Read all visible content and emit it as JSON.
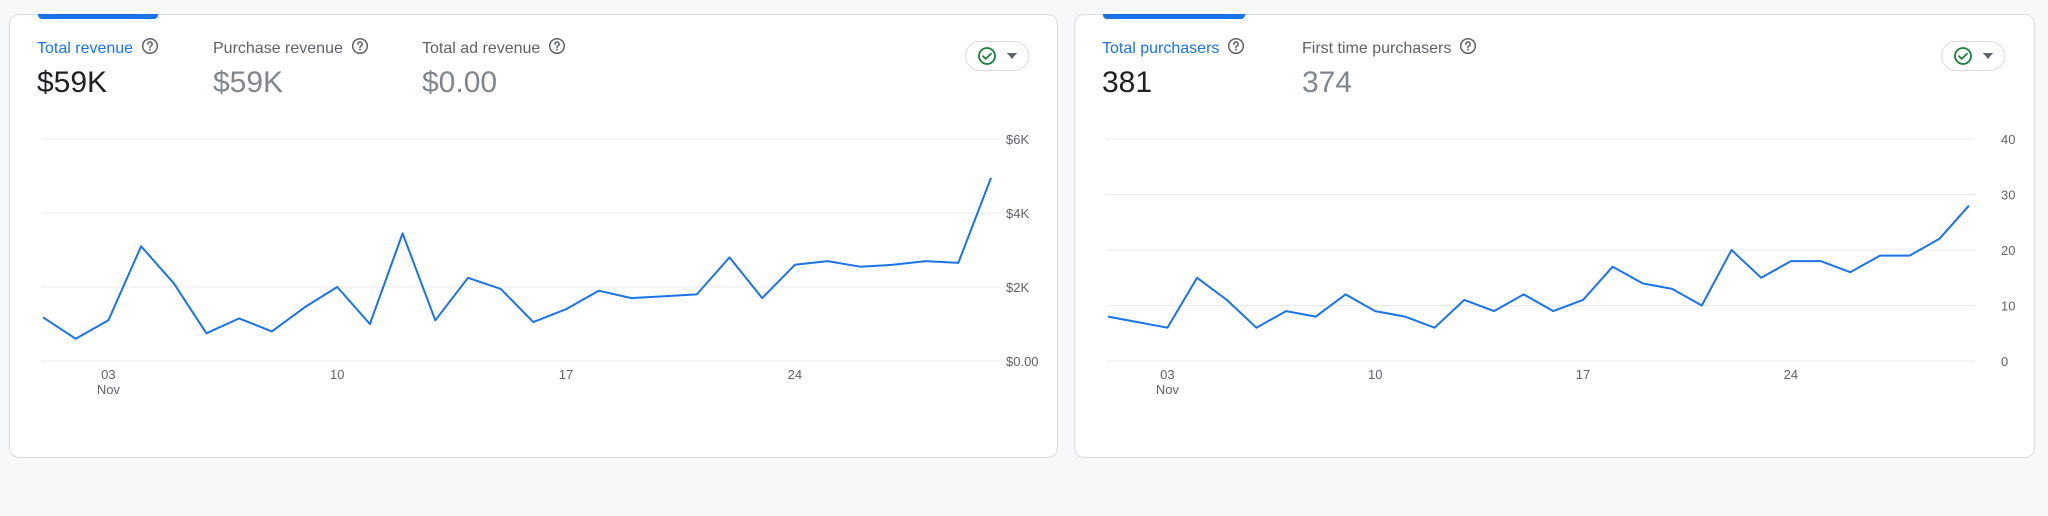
{
  "revenue_card": {
    "metrics": [
      {
        "label": "Total revenue",
        "value": "$59K",
        "active": true
      },
      {
        "label": "Purchase revenue",
        "value": "$59K",
        "active": false
      },
      {
        "label": "Total ad revenue",
        "value": "$0.00",
        "active": false
      }
    ]
  },
  "purchasers_card": {
    "metrics": [
      {
        "label": "Total purchasers",
        "value": "381",
        "active": true
      },
      {
        "label": "First time purchasers",
        "value": "374",
        "active": false
      }
    ]
  },
  "colors": {
    "accent": "#1a73e8",
    "check": "#188038",
    "grid": "#e8eaed"
  },
  "chart_data": [
    {
      "type": "line",
      "series": [
        {
          "values": [
            1180,
            600,
            1100,
            3100,
            2100,
            750,
            1150,
            800,
            1450,
            2000,
            1000,
            3450,
            1100,
            2250,
            1950,
            1050,
            1400,
            1900,
            1700,
            1750,
            1800,
            2800,
            1700,
            2600,
            2700,
            2550,
            2600,
            2700,
            2650,
            4950
          ]
        }
      ],
      "x": [
        1,
        2,
        3,
        4,
        5,
        6,
        7,
        8,
        9,
        10,
        11,
        12,
        13,
        14,
        15,
        16,
        17,
        18,
        19,
        20,
        21,
        22,
        23,
        24,
        25,
        26,
        27,
        28,
        29,
        30
      ],
      "x_tick_labels": [
        {
          "x": 3,
          "label": "03",
          "sub": "Nov"
        },
        {
          "x": 10,
          "label": "10"
        },
        {
          "x": 17,
          "label": "17"
        },
        {
          "x": 24,
          "label": "24"
        }
      ],
      "y_tick_labels": [
        "$0.00",
        "$2K",
        "$4K",
        "$6K"
      ],
      "y_ticks": [
        0,
        2000,
        4000,
        6000
      ],
      "ylim": [
        0,
        6000
      ],
      "grid": true
    },
    {
      "type": "line",
      "series": [
        {
          "values": [
            8,
            7,
            6,
            15,
            11,
            6,
            9,
            8,
            12,
            9,
            8,
            6,
            11,
            9,
            12,
            9,
            11,
            17,
            14,
            13,
            10,
            20,
            15,
            18,
            18,
            16,
            19,
            19,
            22,
            28
          ]
        }
      ],
      "x": [
        1,
        2,
        3,
        4,
        5,
        6,
        7,
        8,
        9,
        10,
        11,
        12,
        13,
        14,
        15,
        16,
        17,
        18,
        19,
        20,
        21,
        22,
        23,
        24,
        25,
        26,
        27,
        28,
        29,
        30
      ],
      "x_tick_labels": [
        {
          "x": 3,
          "label": "03",
          "sub": "Nov"
        },
        {
          "x": 10,
          "label": "10"
        },
        {
          "x": 17,
          "label": "17"
        },
        {
          "x": 24,
          "label": "24"
        }
      ],
      "y_tick_labels": [
        "0",
        "10",
        "20",
        "30",
        "40"
      ],
      "y_ticks": [
        0,
        10,
        20,
        30,
        40
      ],
      "ylim": [
        0,
        40
      ],
      "grid": true
    }
  ]
}
